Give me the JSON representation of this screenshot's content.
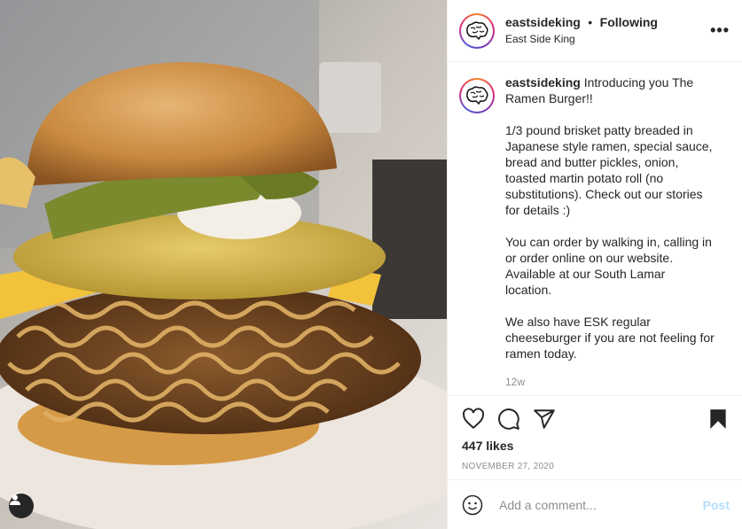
{
  "header": {
    "username": "eastsideking",
    "separator": "•",
    "follow_status": "Following",
    "location": "East Side King",
    "more_label": "•••"
  },
  "caption": {
    "username": "eastsideking",
    "intro": "Introducing you The Ramen Burger!!",
    "paragraphs": [
      "1/3 pound brisket patty breaded in Japanese style ramen, special sauce, bread and butter pickles, onion, toasted martin potato roll (no substitutions). Check out our stories for details :)",
      "You can order by walking in, calling in or order online on our website. Available at our South Lamar location.",
      "We also have ESK regular cheeseburger if you are not feeling for ramen today."
    ],
    "time_ago": "12w"
  },
  "actions": {
    "icons": [
      "heart-icon",
      "comment-icon",
      "share-icon",
      "bookmark-icon"
    ],
    "likes": "447 likes",
    "date": "NOVEMBER 27, 2020"
  },
  "comment_box": {
    "placeholder": "Add a comment...",
    "post_label": "Post"
  },
  "colors": {
    "text": "#262626",
    "muted": "#8e8e8e",
    "post_disabled": "#b2dffc",
    "border": "#efefef"
  }
}
